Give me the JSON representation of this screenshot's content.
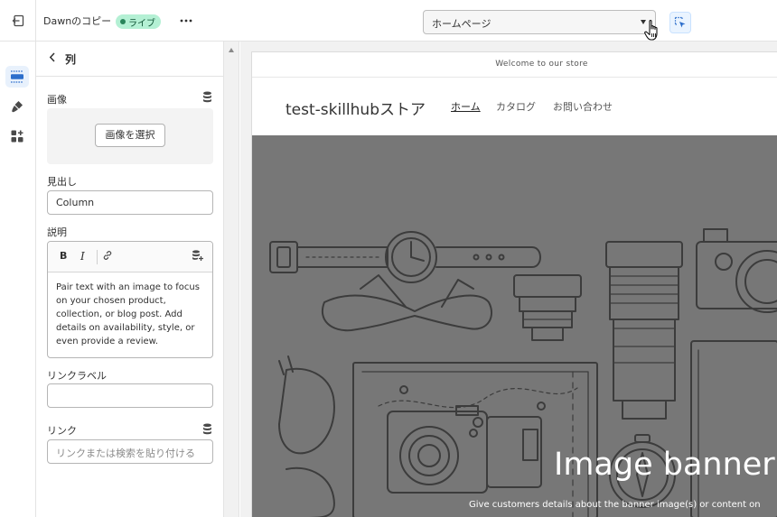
{
  "header": {
    "theme_name": "Dawnのコピー",
    "status_badge": "ライブ",
    "page_selector": "ホームページ",
    "icons": [
      "exit-icon",
      "more-icon",
      "inspector-icon"
    ]
  },
  "rail": {
    "items": [
      {
        "name": "sections",
        "icon": "sections-icon",
        "active": true
      },
      {
        "name": "theme-settings",
        "icon": "brush-icon",
        "active": false
      },
      {
        "name": "apps",
        "icon": "apps-icon",
        "active": false
      }
    ]
  },
  "panel": {
    "title": "列",
    "image": {
      "label": "画像",
      "button": "画像を選択"
    },
    "heading": {
      "label": "見出し",
      "value": "Column"
    },
    "description": {
      "label": "説明",
      "toolbar": {
        "bold": "B",
        "italic": "I"
      },
      "value": "Pair text with an image to focus on your chosen product, collection, or blog post. Add details on availability, style, or even provide a review."
    },
    "link_label": {
      "label": "リンクラベル",
      "value": ""
    },
    "link": {
      "label": "リンク",
      "placeholder": "リンクまたは検索を貼り付ける"
    }
  },
  "preview": {
    "announcement": "Welcome to our store",
    "store_name": "test-skillhubストア",
    "nav": [
      "ホーム",
      "カタログ",
      "お問い合わせ"
    ],
    "banner_title": "Image banner",
    "banner_description": "Give customers details about the banner image(s) or content on"
  },
  "colors": {
    "accent": "#2c6ecb",
    "live_badge_bg": "#b4f0d4",
    "banner_overlay": "#777777"
  }
}
